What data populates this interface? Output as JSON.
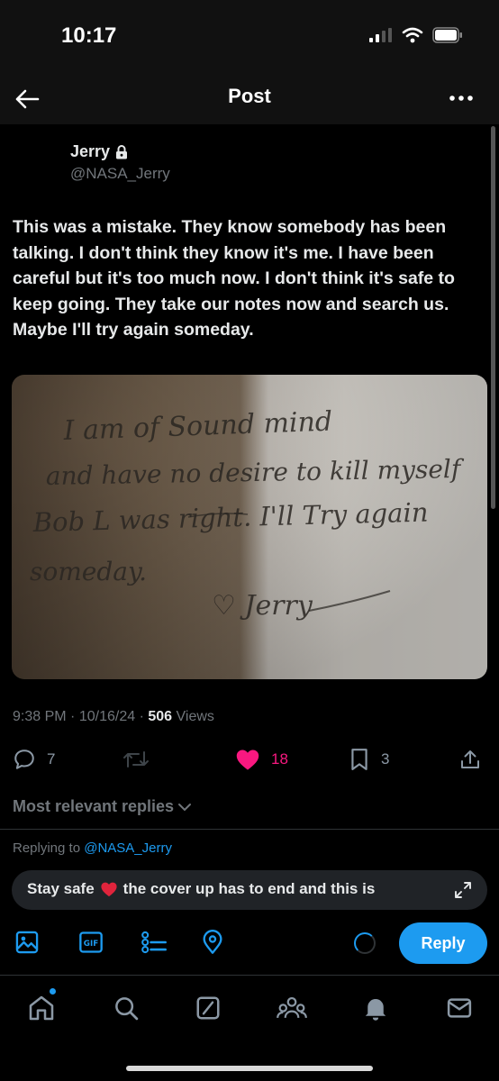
{
  "status_bar": {
    "time": "10:17"
  },
  "header": {
    "title": "Post"
  },
  "author": {
    "name": "Jerry",
    "handle": "@NASA_Jerry"
  },
  "post": {
    "text": "This was a mistake. They know somebody has been talking. I don't think they know it's me. I have been careful but it's too much now. I don't think it's safe to keep going. They take our notes now and search us. Maybe I'll try again someday.",
    "image_handwriting": [
      "I am of Sound mind",
      "and have no desire to kill myself",
      "Bob L was right. I'll Try again",
      "someday.",
      "♡ Jerry"
    ],
    "time": "9:38 PM",
    "date": "10/16/24",
    "views_count": "506",
    "views_label": "Views"
  },
  "actions": {
    "replies": "7",
    "reposts": "",
    "likes": "18",
    "bookmarks": "3"
  },
  "replies_sort": {
    "label": "Most relevant replies"
  },
  "composer": {
    "replying_prefix": "Replying to",
    "replying_handle": "@NASA_Jerry",
    "draft_before": "Stay safe",
    "draft_after": "the cover up has to end and this is",
    "reply_button": "Reply"
  },
  "colors": {
    "accent": "#1d9bf0",
    "like": "#f91880",
    "muted": "#71767b",
    "background": "#000000"
  },
  "icons": {
    "back": "arrow-left-icon",
    "more": "more-horizontal-icon",
    "lock": "lock-icon",
    "reply": "comment-icon",
    "repost": "repost-icon",
    "like": "heart-icon",
    "bookmark": "bookmark-icon",
    "share": "share-icon",
    "chevron": "chevron-down-icon",
    "expand": "expand-icon",
    "media": "image-icon",
    "gif": "gif-icon",
    "poll": "poll-icon",
    "location": "location-icon",
    "tabs": [
      "home-icon",
      "search-icon",
      "grok-icon",
      "communities-icon",
      "notifications-icon",
      "messages-icon"
    ]
  }
}
